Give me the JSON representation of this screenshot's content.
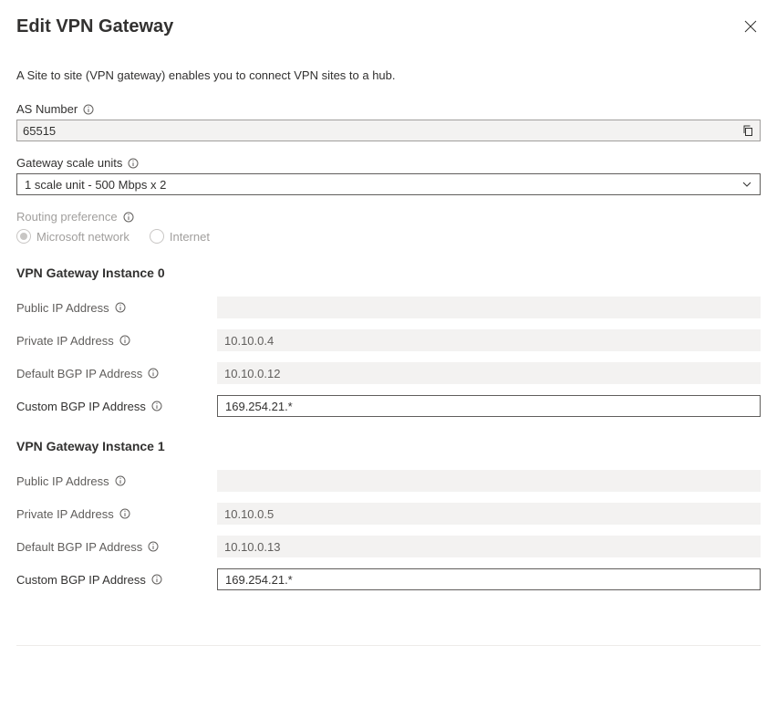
{
  "header": {
    "title": "Edit VPN Gateway"
  },
  "description": "A Site to site (VPN gateway) enables you to connect VPN sites to a hub.",
  "as_number": {
    "label": "AS Number",
    "value": "65515"
  },
  "scale_units": {
    "label": "Gateway scale units",
    "value": "1 scale unit - 500 Mbps x 2"
  },
  "routing_pref": {
    "label": "Routing preference",
    "option_ms": "Microsoft network",
    "option_internet": "Internet"
  },
  "instance0": {
    "heading": "VPN Gateway Instance 0",
    "public_ip_label": "Public IP Address",
    "public_ip_value": "",
    "private_ip_label": "Private IP Address",
    "private_ip_value": "10.10.0.4",
    "default_bgp_label": "Default BGP IP Address",
    "default_bgp_value": "10.10.0.12",
    "custom_bgp_label": "Custom BGP IP Address",
    "custom_bgp_value": "169.254.21.*"
  },
  "instance1": {
    "heading": "VPN Gateway Instance 1",
    "public_ip_label": "Public IP Address",
    "public_ip_value": "",
    "private_ip_label": "Private IP Address",
    "private_ip_value": "10.10.0.5",
    "default_bgp_label": "Default BGP IP Address",
    "default_bgp_value": "10.10.0.13",
    "custom_bgp_label": "Custom BGP IP Address",
    "custom_bgp_value": "169.254.21.*"
  }
}
